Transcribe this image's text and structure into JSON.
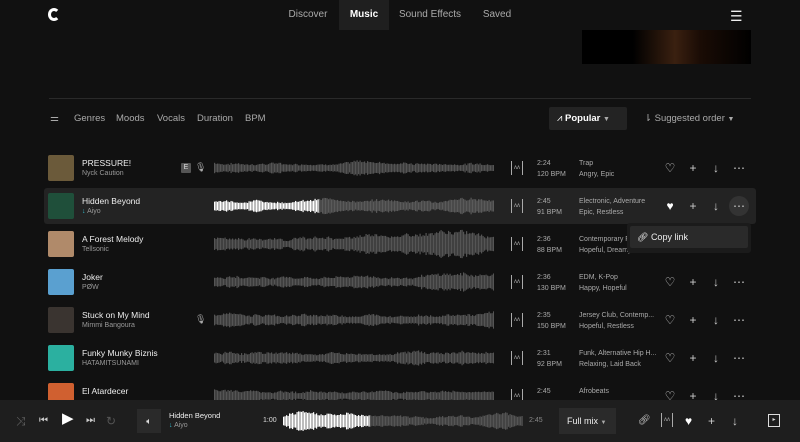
{
  "nav": {
    "tabs": [
      "Discover",
      "Music",
      "Sound Effects",
      "Saved"
    ],
    "active": "Music"
  },
  "filters": {
    "items": [
      "Genres",
      "Moods",
      "Vocals",
      "Duration",
      "BPM"
    ],
    "sort_type": "Popular",
    "order": "Suggested order"
  },
  "tracks": [
    {
      "title": "PRESSURE!",
      "artist": "Nyck Caution",
      "duration": "2:24",
      "bpm": "120 BPM",
      "genres": "Trap",
      "moods": "Angry, Epic",
      "explicit": "E",
      "vocals": true,
      "art": "#6b5a3a"
    },
    {
      "title": "Hidden Beyond",
      "artist": "Aiyo",
      "duration": "2:45",
      "bpm": "91 BPM",
      "genres": "Electronic, Adventure",
      "moods": "Epic, Restless",
      "art": "#1f4f3a",
      "liked": true
    },
    {
      "title": "A Forest Melody",
      "artist": "Tellsonic",
      "duration": "2:36",
      "bpm": "88 BPM",
      "genres": "Contemporary Folk",
      "moods": "Hopeful, Dreamy",
      "art": "#b08a6a"
    },
    {
      "title": "Joker",
      "artist": "PØW",
      "duration": "2:36",
      "bpm": "130 BPM",
      "genres": "EDM, K-Pop",
      "moods": "Happy, Hopeful",
      "art": "#5aa0d0"
    },
    {
      "title": "Stuck on My Mind",
      "artist": "Mimmi Bangoura",
      "duration": "2:35",
      "bpm": "150 BPM",
      "genres": "Jersey Club, Contemp...",
      "moods": "Hopeful, Restless",
      "vocals": true,
      "art": "#3a3430"
    },
    {
      "title": "Funky Munky Biznis",
      "artist": "HATAMITSUNAMI",
      "duration": "2:31",
      "bpm": "92 BPM",
      "genres": "Funk, Alternative Hip H...",
      "moods": "Relaxing, Laid Back",
      "art": "#2bb0a0"
    },
    {
      "title": "El Atardecer",
      "artist": "",
      "duration": "2:45",
      "bpm": "",
      "genres": "Afrobeats",
      "moods": "",
      "art": "#d06030"
    }
  ],
  "context_menu": {
    "copy_link": "Copy link"
  },
  "player": {
    "title": "Hidden Beyond",
    "artist": "Aiyo",
    "elapsed": "1:00",
    "total": "2:45",
    "mix": "Full mix",
    "progress": 0.36
  }
}
